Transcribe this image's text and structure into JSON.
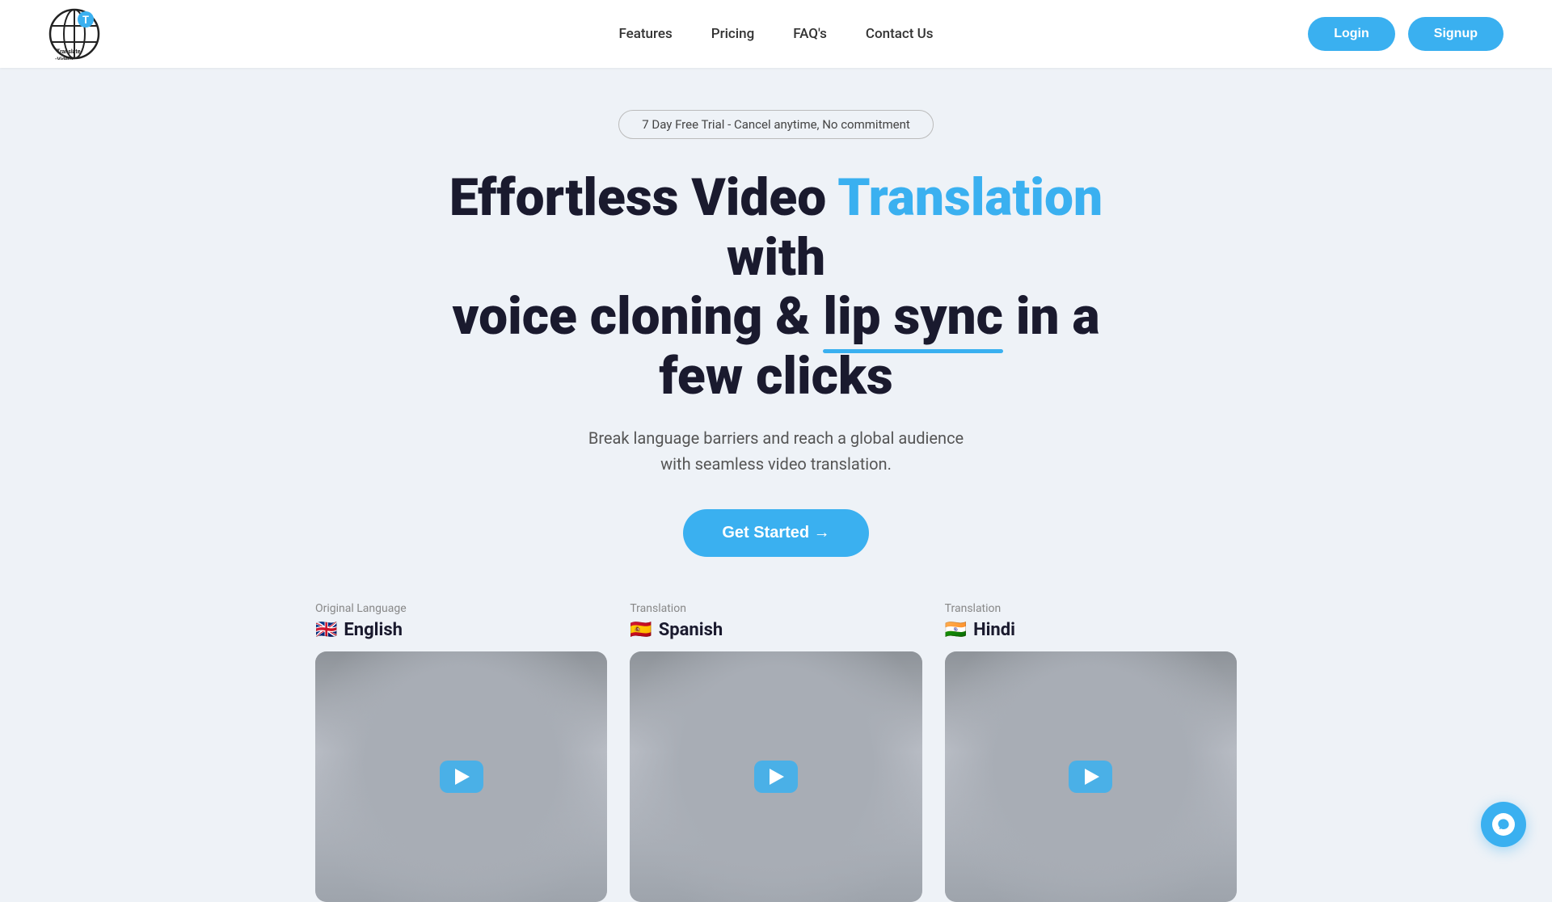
{
  "nav": {
    "logo_alt": "Translate Videos",
    "logo_text_line1": "Translate",
    "logo_text_line2": "-Videos-",
    "links": [
      {
        "label": "Features",
        "href": "#"
      },
      {
        "label": "Pricing",
        "href": "#"
      },
      {
        "label": "FAQ's",
        "href": "#"
      },
      {
        "label": "Contact Us",
        "href": "#"
      }
    ],
    "login_label": "Login",
    "signup_label": "Signup"
  },
  "hero": {
    "trial_badge": "7 Day Free Trial - Cancel anytime, No commitment",
    "title_part1": "Effortless Video ",
    "title_highlight": "Translation",
    "title_part2": " with",
    "title_line2_part1": "voice cloning & ",
    "title_underline": "lip sync",
    "title_line2_part2": " in a few clicks",
    "subtitle_line1": "Break language barriers and reach a global audience",
    "subtitle_line2": "with seamless video translation.",
    "cta_label": "Get Started →"
  },
  "videos": {
    "columns": [
      {
        "label": "Original Language",
        "flag": "🇬🇧",
        "language": "English"
      },
      {
        "label": "Translation",
        "flag": "🇪🇸",
        "language": "Spanish"
      },
      {
        "label": "Translation",
        "flag": "🇮🇳",
        "language": "Hindi"
      }
    ]
  },
  "chat": {
    "label": "Chat support"
  },
  "colors": {
    "accent": "#3ab0f0",
    "dark": "#1a1a2e"
  }
}
